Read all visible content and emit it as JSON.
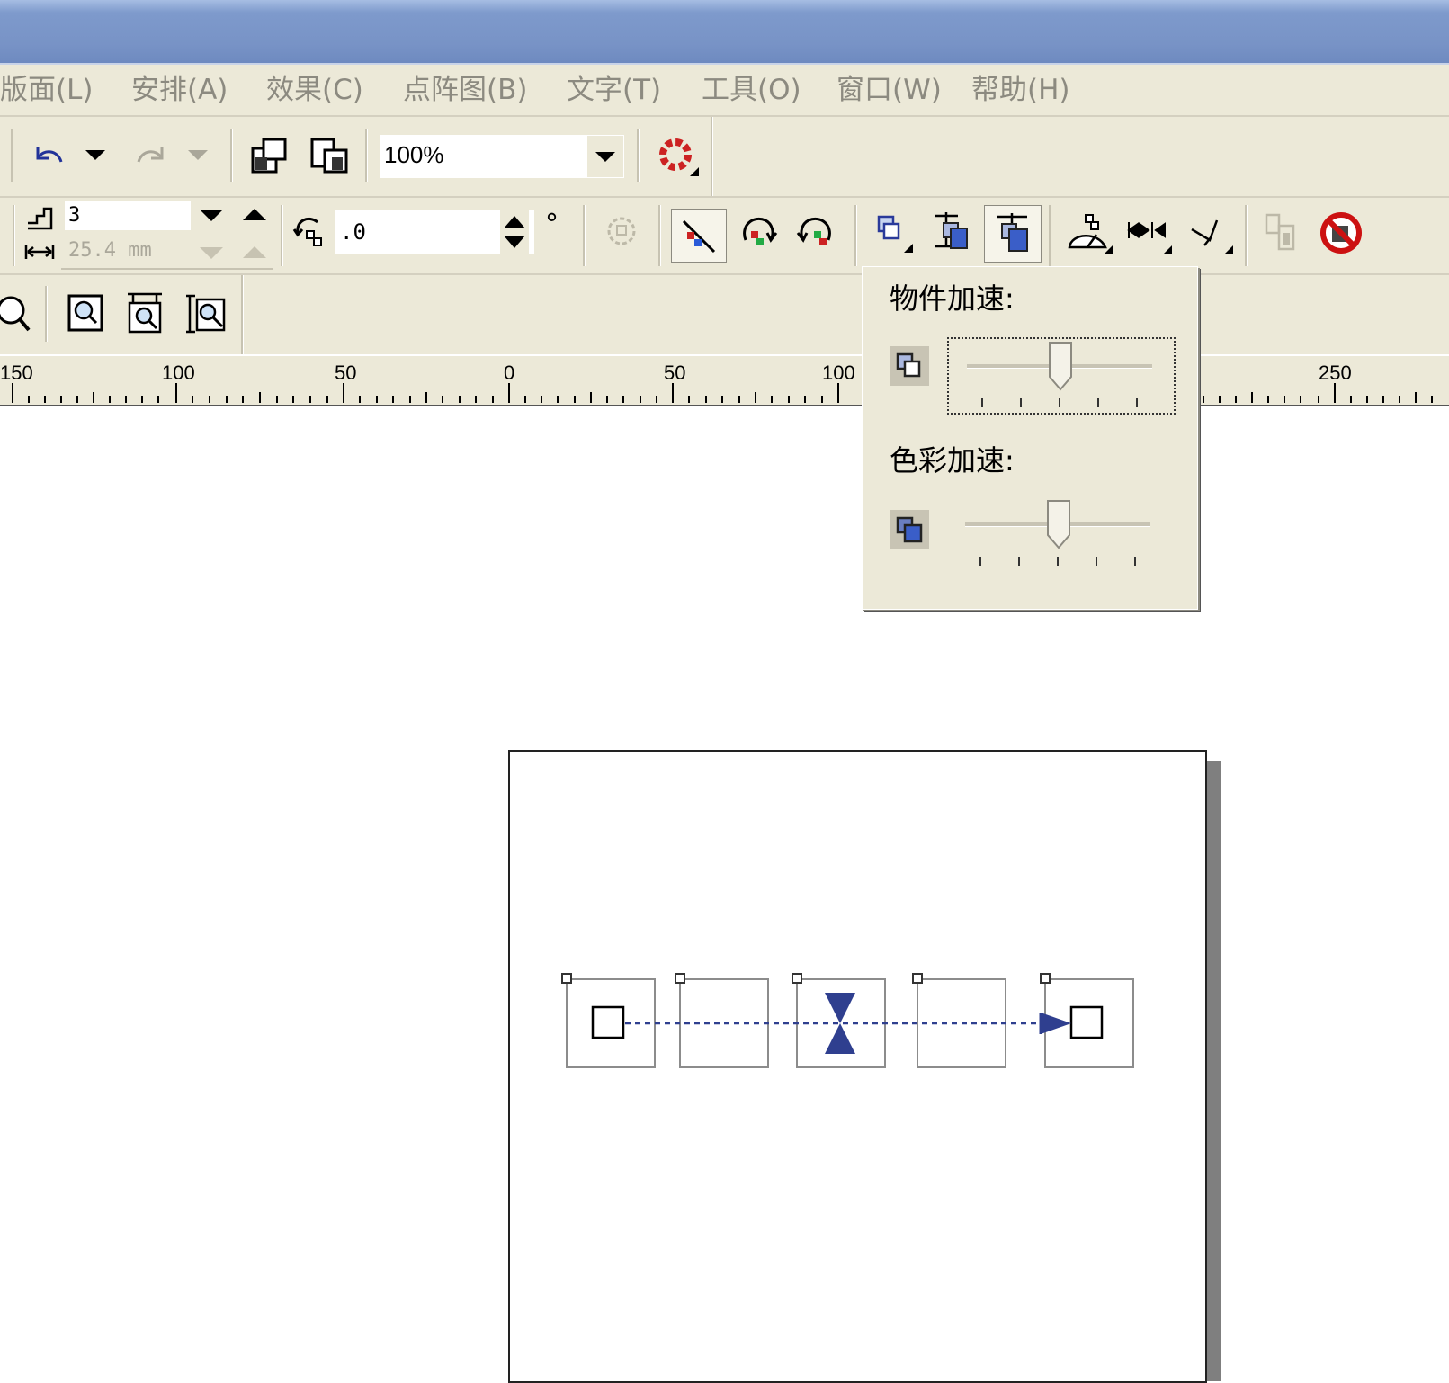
{
  "menu": {
    "items": [
      "版面(L)",
      "安排(A)",
      "效果(C)",
      "点阵图(B)",
      "文字(T)",
      "工具(O)",
      "窗口(W)",
      "帮助(H)"
    ]
  },
  "toolbar1": {
    "zoom_value": "100%",
    "icons": [
      "undo-icon",
      "undo-dropdown-icon",
      "redo-icon",
      "redo-dropdown-icon",
      "import-icon",
      "export-icon",
      "zoom-dropdown-icon",
      "corel-launcher-icon"
    ]
  },
  "toolbar2": {
    "steps_value": "3",
    "spacing_value": "25.4 mm",
    "rotation_value": ".0",
    "degree_symbol": "°"
  },
  "ruler": {
    "labels": [
      "150",
      "100",
      "50",
      "0",
      "50",
      "100",
      "250"
    ]
  },
  "popup": {
    "object_accel_label": "物件加速:",
    "color_accel_label": "色彩加速:",
    "object_accel_level": 0.5,
    "color_accel_level": 0.5
  },
  "colors": {
    "title_bar": "#7893c6",
    "chrome": "#ece9d8",
    "blend_accent": "#2f3f8f",
    "menu_text_disabled": "#8c8a80"
  }
}
